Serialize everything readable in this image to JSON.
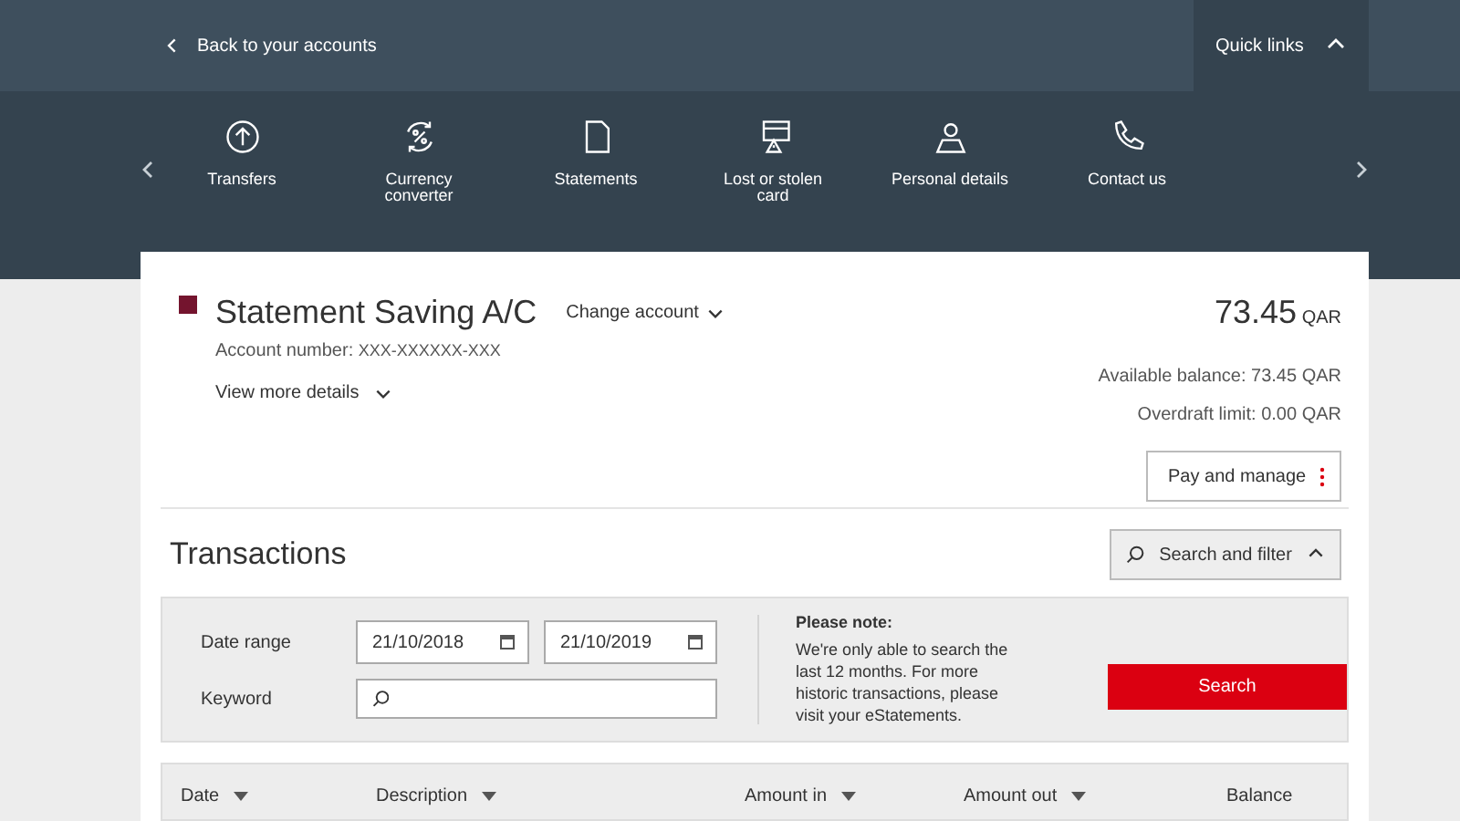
{
  "back_link": "Back to your accounts",
  "quick_links": {
    "title": "Quick links",
    "expanded": true
  },
  "shortcuts": [
    {
      "label": "Transfers"
    },
    {
      "label": "Currency converter"
    },
    {
      "label": "Statements"
    },
    {
      "label": "Lost or stolen card"
    },
    {
      "label": "Personal details"
    },
    {
      "label": "Contact us"
    }
  ],
  "account": {
    "name": "Statement Saving A/C",
    "change_label": "Change account",
    "number_label": "Account number:",
    "number": "XXX-XXXXXX-XXX",
    "details_label": "View more details",
    "balance": "73.45",
    "currency": "QAR",
    "available": "Available balance: 73.45 QAR",
    "overdraft": "Overdraft limit: 0.00 QAR",
    "action_button": "Pay and manage"
  },
  "transactions": {
    "title": "Transactions",
    "filter_button": "Search and filter",
    "filter_expanded": true
  },
  "filter": {
    "date_label": "Date range",
    "from": "21/10/2018",
    "to": "21/10/2019",
    "keyword_label": "Keyword",
    "note_title": "Please note:",
    "note_text": "We're only able to search the last 12 months. For more historic transactions, please visit your eStatements.",
    "search_button": "Search"
  },
  "columns": [
    {
      "label": "Date",
      "sortable": true
    },
    {
      "label": "Description",
      "sortable": true
    },
    {
      "label": "Amount in",
      "sortable": true
    },
    {
      "label": "Amount out",
      "sortable": true
    },
    {
      "label": "Balance",
      "sortable": false
    }
  ]
}
